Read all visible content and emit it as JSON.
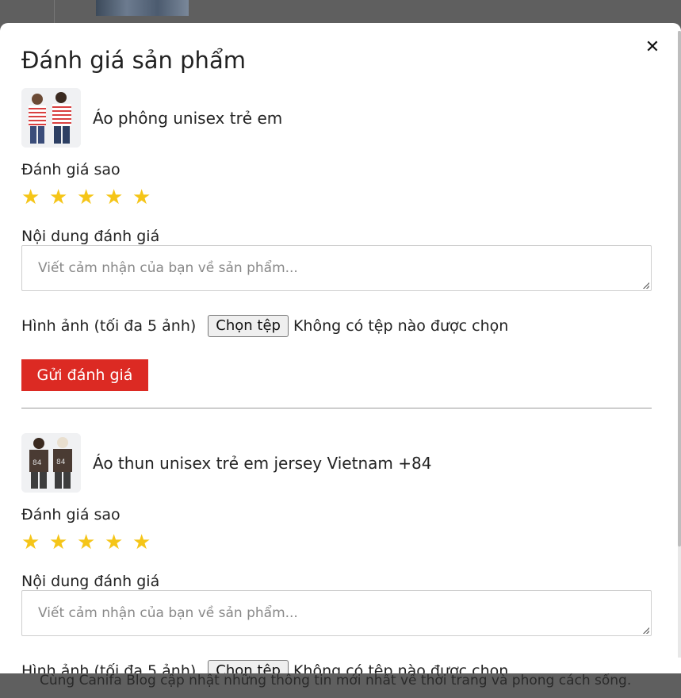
{
  "background": {
    "footer_text": "Cùng Canifa Blog cập nhật những thông tin mới nhất về thời trang và phong cách sống."
  },
  "modal": {
    "title": "Đánh giá sản phẩm",
    "close_icon": "close-icon"
  },
  "reviews": [
    {
      "product_name": "Áo phông unisex trẻ em",
      "rating_label": "Đánh giá sao",
      "stars": 5,
      "content_label": "Nội dung đánh giá",
      "content_placeholder": "Viết cảm nhận của bạn về sản phẩm...",
      "image_label": "Hình ảnh (tối đa 5 ảnh)",
      "file_button": "Chọn tệp",
      "file_status": "Không có tệp nào được chọn",
      "submit_label": "Gửi đánh giá"
    },
    {
      "product_name": "Áo thun unisex trẻ em jersey Vietnam +84",
      "rating_label": "Đánh giá sao",
      "stars": 5,
      "content_label": "Nội dung đánh giá",
      "content_placeholder": "Viết cảm nhận của bạn về sản phẩm...",
      "image_label": "Hình ảnh (tối đa 5 ảnh)",
      "file_button": "Chọn tệp",
      "file_status": "Không có tệp nào được chọn"
    }
  ],
  "colors": {
    "star": "#f5c518",
    "submit": "#dc2a23",
    "overlay": "#5f5f5f"
  }
}
